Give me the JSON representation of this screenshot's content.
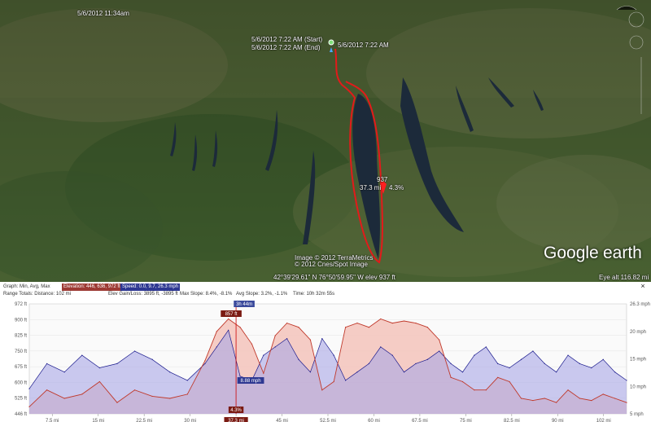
{
  "map": {
    "top_timestamp": "5/6/2012 11:34am",
    "start_label": "5/6/2012 7:22 AM (Start)",
    "end_label": "5/6/2012 7:22 AM (End)",
    "marker_label": "5/6/2012 7:22 AM",
    "cursor_elev": "937",
    "cursor_distance": "37.3 mi",
    "cursor_slope": "4.3%",
    "attribution_1": "Image © 2012 TerraMetrics",
    "attribution_2": "© 2012 Cnes/Spot Image",
    "coordinates": "42°39'29.61\" N  76°50'59.95\" W  elev  937 ft",
    "eye_alt": "Eye alt  116.82 mi",
    "logo_google": "Google",
    "logo_earth": "earth",
    "colors": {
      "track": "#e31a1a",
      "water": "#1c2a3a",
      "terrain": "#4e6a35"
    }
  },
  "elevation_panel": {
    "stats_row1": {
      "graph_label": "Graph: Min, Avg, Max",
      "elevation": "Elevation: 446, 636, 972 ft",
      "speed": "Speed: 0.0, 9.7, 26.3 mph"
    },
    "stats_row2": {
      "range_totals": "Range Totals: Distance: 102 mi",
      "elev_gain": "Elev Gain/Loss: 3895 ft, -3895 ft",
      "max_slope": "Max Slope: 8.4%, -8.1%",
      "avg_slope": "Avg Slope: 3.2%, -1.1%",
      "time": "Time: 10h 32m 55s"
    },
    "close_label": "×",
    "elevation_axis_labels": [
      "972 ft",
      "900 ft",
      "825 ft",
      "750 ft",
      "675 ft",
      "600 ft",
      "525 ft",
      "446 ft"
    ],
    "speed_axis_labels": [
      "26.3 mph",
      "20 mph",
      "15 mph",
      "10 mph",
      "5 mph"
    ],
    "distance_ticks": [
      "7.5 mi",
      "15 mi",
      "22.5 mi",
      "30 mi",
      "37.3 mi",
      "45 mi",
      "52.5 mi",
      "60 mi",
      "67.5 mi",
      "75 mi",
      "82.5 mi",
      "90 mi",
      "102 mi"
    ],
    "cursor_time_label": "3h 44m",
    "cursor_elev_label": "857 ft",
    "cursor_speed_label": "8.88 mph",
    "cursor_slope_label": "4.3%",
    "cursor_distance_label": "37.3 mi",
    "colors": {
      "elevation_line": "#c0392b",
      "elevation_fill": "#f4c0b8",
      "speed_line": "#1a1a8c",
      "speed_fill": "#a9a6e6",
      "overlap_fill": "#c08cc4"
    }
  },
  "chart_data": {
    "type": "area",
    "xlabel": "",
    "ylabel": "",
    "xlim": [
      0,
      102
    ],
    "ylim": [
      446,
      972
    ],
    "y2lim": [
      0,
      26.3
    ],
    "x": [
      0,
      3,
      6,
      9,
      12,
      15,
      18,
      21,
      24,
      27,
      30,
      32,
      34,
      36,
      38,
      40,
      42,
      44,
      46,
      48,
      50,
      52,
      54,
      56,
      58,
      60,
      62,
      64,
      66,
      68,
      70,
      72,
      74,
      76,
      78,
      80,
      82,
      84,
      86,
      88,
      90,
      92,
      94,
      96,
      98,
      100,
      102
    ],
    "series": [
      {
        "name": "Elevation",
        "values": [
          480,
          560,
          520,
          540,
          600,
          500,
          560,
          530,
          520,
          540,
          700,
          840,
          900,
          860,
          780,
          640,
          820,
          880,
          860,
          800,
          560,
          600,
          860,
          880,
          860,
          900,
          880,
          890,
          880,
          860,
          800,
          620,
          600,
          560,
          560,
          620,
          600,
          520,
          510,
          520,
          500,
          560,
          520,
          510,
          540,
          520,
          500
        ]
      },
      {
        "name": "Speed",
        "values": [
          6,
          12,
          10,
          14,
          11,
          12,
          15,
          13,
          10,
          8,
          12,
          16,
          20,
          9,
          8,
          14,
          16,
          18,
          13,
          10,
          18,
          14,
          8,
          10,
          12,
          16,
          14,
          10,
          12,
          13,
          15,
          12,
          10,
          14,
          16,
          12,
          11,
          13,
          15,
          12,
          10,
          14,
          12,
          11,
          13,
          10,
          8
        ]
      }
    ]
  }
}
